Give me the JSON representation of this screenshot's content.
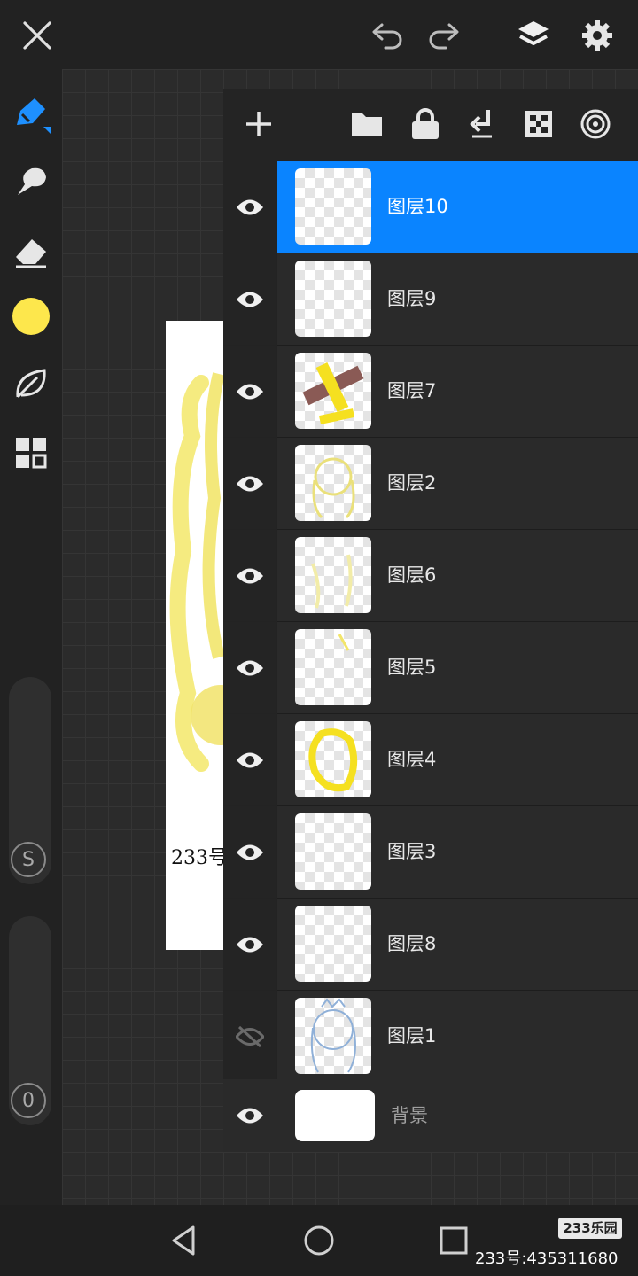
{
  "toolbar": {
    "close_icon": "close-icon",
    "undo_icon": "undo-icon",
    "redo_icon": "redo-icon",
    "layers_icon": "layers-icon",
    "settings_icon": "gear-icon"
  },
  "sidebar": {
    "tools": [
      "brush-tool-icon",
      "smudge-tool-icon",
      "eraser-tool-icon",
      "color-swatch",
      "leaf-tool-icon",
      "grid-tool-icon"
    ],
    "current_color": "#fde74c",
    "size_slider_badge": "S",
    "opacity_slider_badge": "0"
  },
  "layers_panel": {
    "toolbar_icons": [
      "add-icon",
      "folder-icon",
      "lock-icon",
      "merge-down-icon",
      "checker-icon",
      "target-icon"
    ],
    "layers": [
      {
        "name": "图层10",
        "visible": true,
        "selected": true
      },
      {
        "name": "图层9",
        "visible": true,
        "selected": false
      },
      {
        "name": "图层7",
        "visible": true,
        "selected": false
      },
      {
        "name": "图层2",
        "visible": true,
        "selected": false
      },
      {
        "name": "图层6",
        "visible": true,
        "selected": false
      },
      {
        "name": "图层5",
        "visible": true,
        "selected": false
      },
      {
        "name": "图层4",
        "visible": true,
        "selected": false
      },
      {
        "name": "图层3",
        "visible": true,
        "selected": false
      },
      {
        "name": "图层8",
        "visible": true,
        "selected": false
      },
      {
        "name": "图层1",
        "visible": false,
        "selected": false
      }
    ],
    "background_layer": {
      "name": "背景",
      "visible": true
    }
  },
  "canvas": {
    "signature_text": "233号"
  },
  "navbar": {
    "icons": [
      "back-icon",
      "home-icon",
      "recents-icon"
    ]
  },
  "watermark": {
    "logo": "233乐园",
    "id_text": "233号:435311680"
  },
  "colors": {
    "accent": "#0a84ff",
    "brush_yellow": "#fde74c"
  }
}
